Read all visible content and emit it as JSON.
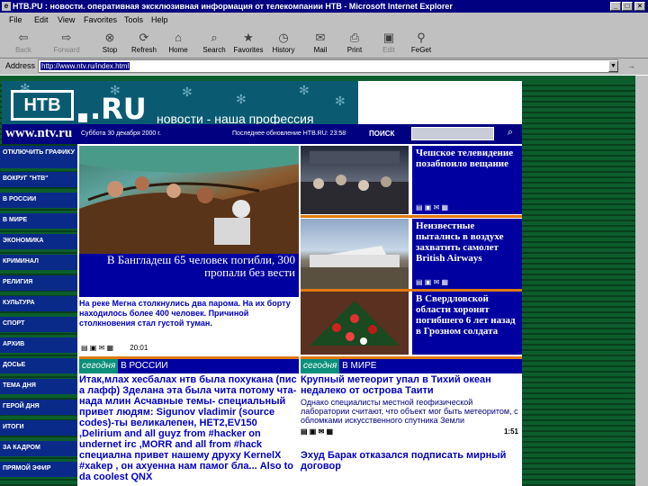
{
  "window": {
    "title": "НТВ.РU : новости. оперативная эксклюзивная информация от телекомпании НТВ - Microsoft Internet Explorer",
    "icon_name": "ie-icon",
    "min": "_",
    "max": "□",
    "close": "×"
  },
  "menu": {
    "items": [
      "File",
      "Edit",
      "View",
      "Favorites",
      "Tools",
      "Help"
    ]
  },
  "toolbar": {
    "buttons": [
      {
        "label": "Back",
        "icon": "back-arrow-icon",
        "glyph": "⇦"
      },
      {
        "label": "Forward",
        "icon": "forward-arrow-icon",
        "glyph": "⇨"
      },
      {
        "label": "Stop",
        "icon": "stop-icon",
        "glyph": "⊗"
      },
      {
        "label": "Refresh",
        "icon": "refresh-icon",
        "glyph": "⟳"
      },
      {
        "label": "Home",
        "icon": "home-icon",
        "glyph": "⌂"
      },
      {
        "label": "Search",
        "icon": "search-icon",
        "glyph": "⌕"
      },
      {
        "label": "Favorites",
        "icon": "favorites-icon",
        "glyph": "★"
      },
      {
        "label": "History",
        "icon": "history-icon",
        "glyph": "◷"
      },
      {
        "label": "Mail",
        "icon": "mail-icon",
        "glyph": "✉"
      },
      {
        "label": "Print",
        "icon": "print-icon",
        "glyph": "⎙"
      },
      {
        "label": "Edit",
        "icon": "edit-icon",
        "glyph": "▣"
      },
      {
        "label": "FeGet",
        "icon": "feget-icon",
        "glyph": "⚲"
      }
    ]
  },
  "address": {
    "label": "Address",
    "value": "http://www.ntv.ru/index.html",
    "go_icon": "→"
  },
  "site": {
    "logo_text": "НТВ",
    "logo_ru": ".RU",
    "slogan": "новости - наша профессия",
    "url": "www.ntv.ru",
    "date": "Суббота 30 декабря 2000 г.",
    "updated": "Последнее обновление НТВ.RU: 23:58",
    "search_label": "ПОИСК",
    "search_icon": "magnifier-icon",
    "search_glyph": "⌕"
  },
  "nav": {
    "items": [
      {
        "label": "ОТКЛЮЧИТЬ ГРАФИКУ",
        "tall": true
      },
      {
        "label": "ВОКРУГ \"НТВ\"",
        "tall": false
      },
      {
        "label": "В РОССИИ",
        "tall": false
      },
      {
        "label": "В МИРЕ",
        "tall": false
      },
      {
        "label": "ЭКОНОМИКА",
        "tall": false
      },
      {
        "label": "КРИМИНАЛ",
        "tall": false
      },
      {
        "label": "РЕЛИГИЯ",
        "tall": false
      },
      {
        "label": "КУЛЬТУРА",
        "tall": false
      },
      {
        "label": "СПОРТ",
        "tall": false
      },
      {
        "label": "АРХИВ",
        "tall": false
      },
      {
        "label": "ДОСЬЕ",
        "tall": false
      },
      {
        "label": "ТЕМА ДНЯ",
        "tall": false
      },
      {
        "label": "ГЕРОЙ ДНЯ",
        "tall": false
      },
      {
        "label": "ИТОГИ",
        "tall": false
      },
      {
        "label": "ЗА КАДРОМ",
        "tall": false
      },
      {
        "label": "ПРЯМОЙ ЭФИР",
        "tall": false
      }
    ]
  },
  "main_story": {
    "headline": "В Бангладеш 65 человек погибли, 300 пропали без вести",
    "lead": "На реке Мегна столкнулись два парома. На их борту находилось более 400 человек. Причиной столкновения стал густой туман.",
    "time": "20:01"
  },
  "side_stories": [
    {
      "title": "Чешское телевидение позабпоило вещание"
    },
    {
      "title": "Неизвестные пытались в воздухе захватить самолет British Airways"
    },
    {
      "title": "В Свердловской области хоронят погибшего 6 лет назад в Грозном солдата"
    }
  ],
  "side_tools": "▤ ▣ ✉ ▦",
  "sections": {
    "russia": {
      "prefix": "сегодня",
      "title": "В РОССИИ",
      "body": "Итак,млах хесбалах нтв была похукана (пис а лафф) Зделана эта была чита потому чта-нада млин Асчавные темы- специальный привет людям: Sigunov vladimir (source codes)-ты великалепен, HET2,EV150 ,Delirium and all guyz from #hacker on undernet irc ,MORR and all from #hack специална привет нашему друху KernelX #xakep , он ахуенна нам памог бла... Also to da coolest QNX"
    },
    "world": {
      "prefix": "сегодня",
      "title": "В МИРЕ",
      "headline": "Крупный метеорит упал в Тихий океан недалеко от острова Таити",
      "body": "Однако специалисты местной геофизической лаборатории считают, что объект мог быть метеоритом, с обломками искусственного спутника Земли",
      "time": "1:51",
      "headline2": "Эхуд Барак отказался подписать мирный договор"
    }
  }
}
